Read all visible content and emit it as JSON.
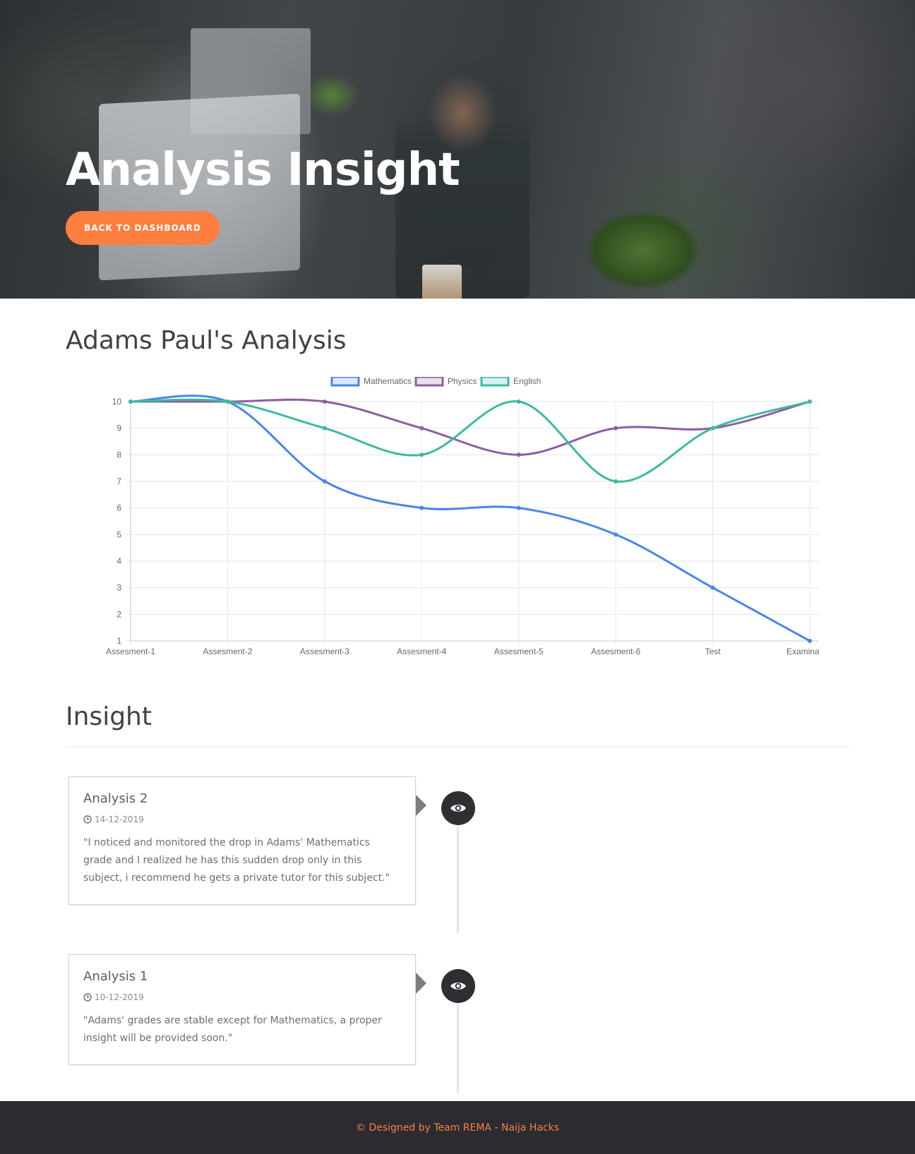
{
  "hero": {
    "title": "Analysis Insight",
    "back_button_label": "BACK TO DASHBOARD"
  },
  "analysis": {
    "title": "Adams Paul's Analysis"
  },
  "chart_data": {
    "type": "line",
    "categories": [
      "Assesment-1",
      "Assesment-2",
      "Assesment-3",
      "Assesment-4",
      "Assesment-5",
      "Assesment-6",
      "Test",
      "Examination"
    ],
    "series": [
      {
        "name": "Mathematics",
        "color": "#4a86e8",
        "values": [
          10,
          10,
          7,
          6,
          6,
          5,
          3,
          1
        ]
      },
      {
        "name": "Physics",
        "color": "#8e5ea2",
        "values": [
          10,
          10,
          10,
          9,
          8,
          9,
          9,
          10
        ]
      },
      {
        "name": "English",
        "color": "#3cba9f",
        "values": [
          10,
          10,
          9,
          8,
          10,
          7,
          9,
          10
        ]
      }
    ],
    "ylim": [
      1,
      10
    ],
    "yticks": [
      10,
      9,
      8,
      7,
      6,
      5,
      4,
      3,
      2,
      1
    ],
    "grid": true,
    "legend": "top-center",
    "title": "",
    "xlabel": "",
    "ylabel": ""
  },
  "insight": {
    "title": "Insight",
    "items": [
      {
        "title": "Analysis 2",
        "date": "14-12-2019",
        "text": "\"I noticed and monitored the drop in Adams' Mathematics grade and I realized he has this sudden drop only in this subject, i recommend he gets a private tutor for this subject.\""
      },
      {
        "title": "Analysis 1",
        "date": "10-12-2019",
        "text": "\"Adams' grades are stable except for Mathematics, a proper insight will be provided soon.\""
      }
    ]
  },
  "footer": {
    "text": "© Designed by Team REMA - Naija Hacks"
  },
  "colors": {
    "accent": "#fd7e3f",
    "footer_bg": "#2a2c31",
    "eye_circle": "#2d2f33"
  },
  "icons": {
    "timeline": "eye-icon",
    "date": "clock-icon"
  }
}
